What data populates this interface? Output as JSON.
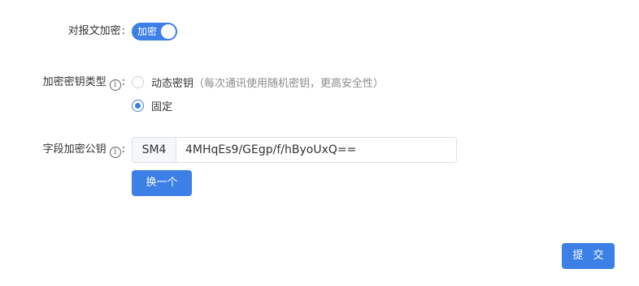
{
  "encrypt_message": {
    "label": "对报文加密",
    "colon": ":",
    "toggle_text": "加密",
    "enabled": true
  },
  "key_type": {
    "label": "加密密钥类型",
    "info_icon": "info-circle-icon",
    "colon": ":",
    "options": [
      {
        "label": "动态密钥",
        "hint": "（每次通讯使用随机密钥，更高安全性）",
        "checked": false
      },
      {
        "label": "固定",
        "hint": "",
        "checked": true
      }
    ]
  },
  "public_key": {
    "label": "字段加密公钥",
    "info_icon": "info-circle-icon",
    "colon": ":",
    "prefix": "SM4",
    "value": "4MHqEs9/GEgp/f/hByoUxQ==",
    "change_button": "换一个"
  },
  "submit_button": "提 交",
  "colors": {
    "primary": "#3c7fe6",
    "text": "#333333",
    "hint": "#8a8a8a",
    "border": "#dcdfe6"
  }
}
